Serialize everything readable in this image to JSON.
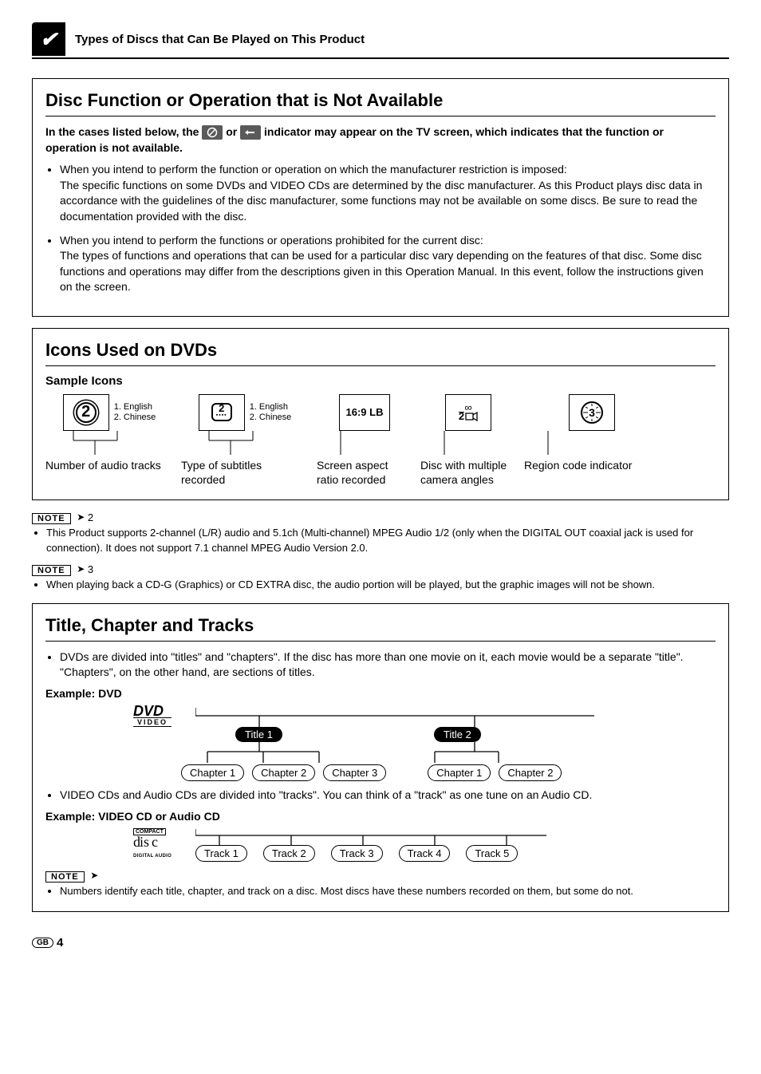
{
  "header": {
    "title": "Types of Discs that Can Be Played on This Product"
  },
  "section1": {
    "heading": "Disc Function or Operation that is Not Available",
    "intro_pre": "In the cases listed below, the ",
    "intro_mid": " or ",
    "intro_post": " indicator may appear on the TV screen, which indicates that the function or operation is not available.",
    "bullets": [
      {
        "lead": "When you intend to perform the function or operation on which the manufacturer restriction is imposed:",
        "body": "The specific functions on some DVDs and VIDEO CDs are determined by the disc manufacturer. As this Product plays disc data in accordance with the guidelines of the disc manufacturer, some functions may not be available on some discs. Be sure to read the documentation provided with the disc."
      },
      {
        "lead": "When you intend to perform the functions or operations prohibited for the current disc:",
        "body": "The types of functions and operations that can be used for a particular disc vary depending on the features of that disc. Some disc functions and operations may differ from the descriptions given in this Operation Manual. In this event, follow the instructions given on the screen."
      }
    ]
  },
  "section2": {
    "heading": "Icons Used on DVDs",
    "sample_label": "Sample Icons",
    "icons": [
      {
        "glyph": "2",
        "lines": "1. English\n2. Chinese",
        "caption": "Number of audio tracks"
      },
      {
        "glyph": "2",
        "lines": "1. English\n2. Chinese",
        "caption": "Type of subtitles recorded"
      },
      {
        "glyph": "16:9 LB",
        "lines": "",
        "caption": "Screen aspect ratio recorded"
      },
      {
        "glyph": "2",
        "lines": "",
        "caption": "Disc with multiple camera angles",
        "camera": true
      },
      {
        "glyph": "3",
        "lines": "",
        "caption": "Region code indicator",
        "globe": true
      }
    ]
  },
  "notes": {
    "label": "NOTE",
    "n2_num": "2",
    "n2_text": "This Product supports 2-channel (L/R) audio and 5.1ch (Multi-channel) MPEG Audio 1/2 (only when the DIGITAL OUT coaxial jack is used for connection). It does not support 7.1 channel MPEG Audio Version 2.0.",
    "n3_num": "3",
    "n3_text": "When playing back a CD-G (Graphics) or CD EXTRA disc, the audio portion will be played, but the graphic images will not be shown."
  },
  "section3": {
    "heading": "Title, Chapter and Tracks",
    "bullet1": "DVDs are divided into \"titles\" and \"chapters\". If the disc has more than one movie on it, each movie would be a separate \"title\". \"Chapters\", on the other hand, are sections of titles.",
    "example1_label": "Example: DVD",
    "dvd_logo_top": "DVD",
    "dvd_logo_bottom": "VIDEO",
    "titles": [
      "Title 1",
      "Title 2"
    ],
    "chapters_t1": [
      "Chapter 1",
      "Chapter 2",
      "Chapter 3"
    ],
    "chapters_t2": [
      "Chapter 1",
      "Chapter 2"
    ],
    "bullet2": "VIDEO CDs and Audio CDs are divided into \"tracks\". You can think of a \"track\" as one tune on an Audio CD.",
    "example2_label": "Example: VIDEO CD or Audio CD",
    "cd_logo_top": "COMPACT",
    "cd_logo_mid": "disc",
    "cd_logo_bottom": "DIGITAL AUDIO",
    "tracks": [
      "Track 1",
      "Track 2",
      "Track 3",
      "Track 4",
      "Track 5"
    ],
    "final_note": "Numbers identify each title, chapter, and track on a disc. Most discs have these numbers recorded on them, but some do not."
  },
  "footer": {
    "region": "GB",
    "page": "4"
  }
}
